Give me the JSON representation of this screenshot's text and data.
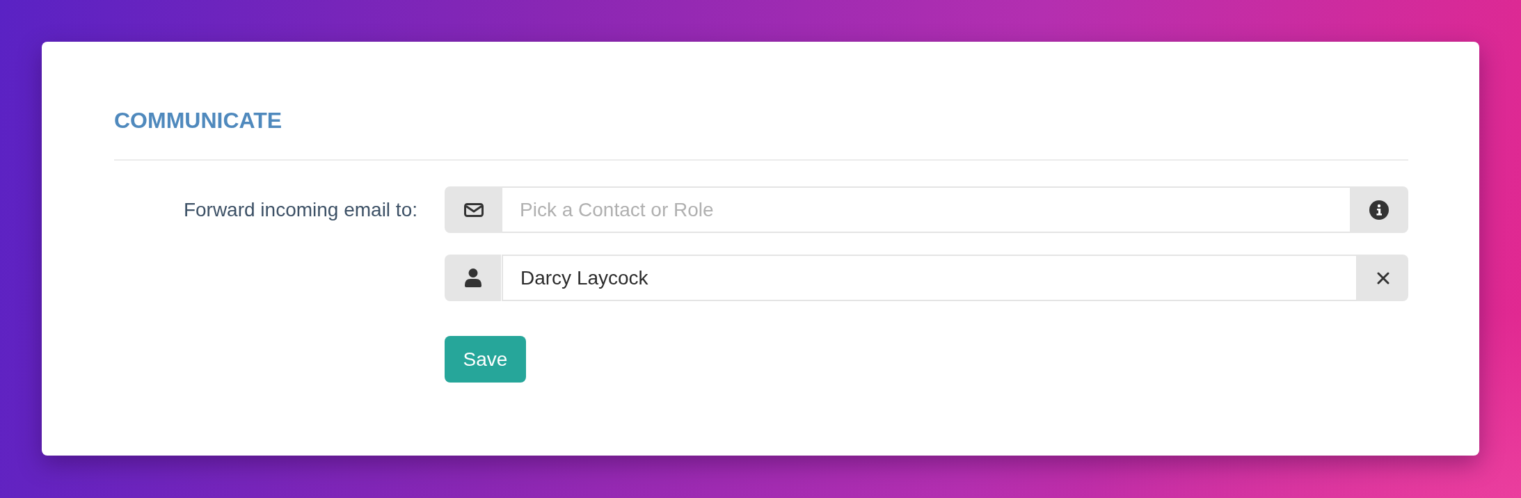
{
  "section": {
    "title": "COMMUNICATE"
  },
  "form": {
    "label": "Forward incoming email to:",
    "picker": {
      "placeholder": "Pick a Contact or Role"
    },
    "recipients": [
      {
        "name": "Darcy Laycock"
      }
    ],
    "save_button": {
      "label": "Save"
    }
  }
}
